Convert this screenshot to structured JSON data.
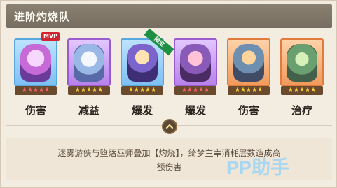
{
  "header": {
    "title": "进阶灼烧队"
  },
  "heroes": [
    {
      "role": "伤害",
      "badge": "MVP",
      "star_color": "#ff6270",
      "stars": "★★★★★"
    },
    {
      "role": "减益",
      "badge": "",
      "star_color": "#ffd43c",
      "stars": "★★★★★"
    },
    {
      "role": "爆发",
      "badge": "限定",
      "star_color": "#ffd43c",
      "stars": "★★★★★"
    },
    {
      "role": "爆发",
      "badge": "",
      "star_color": "#ff6270",
      "stars": "★★★★★"
    },
    {
      "role": "伤害",
      "badge": "",
      "star_color": "#ffd43c",
      "stars": "★★★★★"
    },
    {
      "role": "治疗",
      "badge": "",
      "star_color": "#ffd43c",
      "stars": "★★★★★"
    }
  ],
  "description": {
    "line1": "迷雾游侠与堕落巫师叠加【灼烧】，绮梦主宰消耗层数造成高",
    "line2": "额伤害"
  },
  "watermark": "PP助手",
  "icons": {
    "toggle": "chevron-up-icon"
  },
  "colors": {
    "header": "#7e7568",
    "background": "#f3ece1"
  }
}
